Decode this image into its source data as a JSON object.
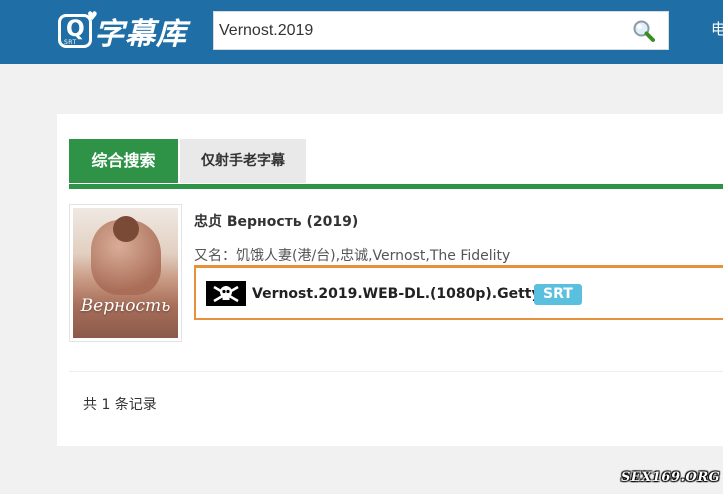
{
  "header": {
    "logo_text": "字幕库",
    "logo_badge": "Q",
    "logo_badge_sub": "SRT",
    "search_value": "Vernost.2019",
    "nav_partial": "电"
  },
  "tabs": [
    {
      "label": "综合搜索",
      "active": true
    },
    {
      "label": "仅射手老字幕",
      "active": false
    }
  ],
  "result": {
    "poster_title": "Верность",
    "title": "忠贞 Верность (2019)",
    "aka": "又名：饥饿人妻(港/台),忠诚,Vernost,The Fidelity",
    "file": {
      "icon": "skull-crossbones-icon",
      "name": "Vernost.2019.WEB-DL.(1080p).Getty.zip",
      "badge": "SRT"
    }
  },
  "record_count_text": "共 1 条记录",
  "watermark": "SEX169.ORG",
  "colors": {
    "header_bg": "#1f6fa6",
    "tab_active": "#2e9247",
    "file_border": "#e8913c",
    "badge": "#5bc0de"
  }
}
